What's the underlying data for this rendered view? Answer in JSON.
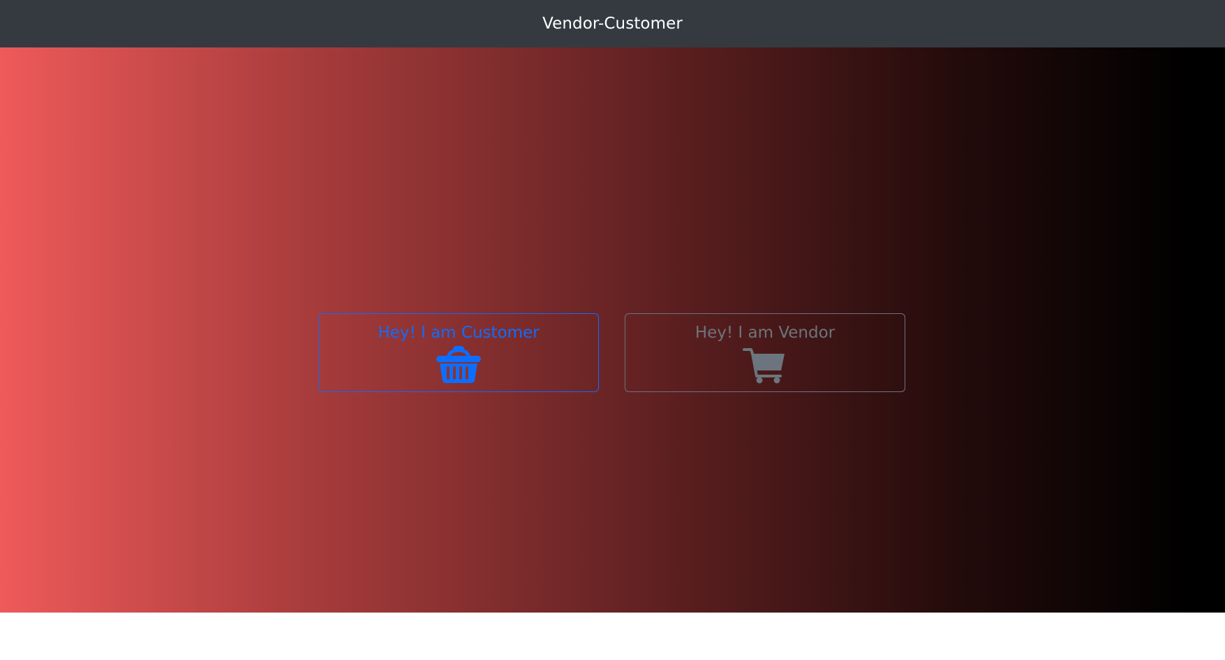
{
  "navbar": {
    "brand": "Vendor-Customer"
  },
  "hero": {
    "gradient_colors": [
      "#ee5a5a",
      "#a83c3c",
      "#5c1f20",
      "#240b0b",
      "#000000"
    ]
  },
  "choices": {
    "customer": {
      "label": "Hey! I am Customer",
      "icon": "basket-icon",
      "color": "#0d6efd"
    },
    "vendor": {
      "label": "Hey! I am Vendor",
      "icon": "cart-icon",
      "color": "#6c757d"
    }
  }
}
